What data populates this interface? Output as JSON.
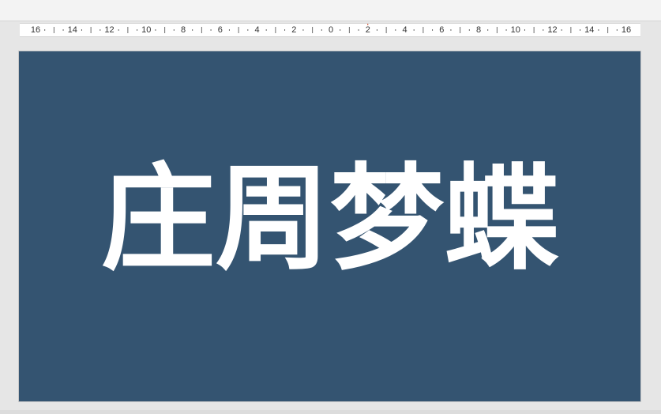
{
  "ruler": {
    "labels": [
      "16",
      "14",
      "12",
      "10",
      "8",
      "6",
      "4",
      "2",
      "0",
      "2",
      "4",
      "6",
      "8",
      "10",
      "12",
      "14",
      "16"
    ],
    "marker_color": "#d24726"
  },
  "slide": {
    "background": "#345471",
    "title": "庄周梦蝶",
    "title_color": "#ffffff"
  }
}
